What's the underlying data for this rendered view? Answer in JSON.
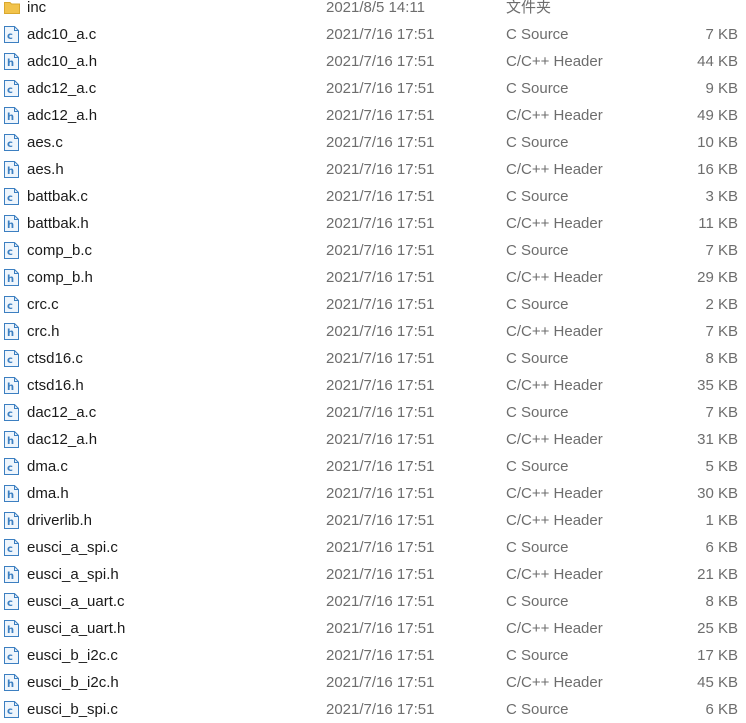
{
  "files": [
    {
      "name": "inc",
      "date": "2021/8/5 14:11",
      "type": "文件夹",
      "size": "",
      "icon": "folder-icon"
    },
    {
      "name": "adc10_a.c",
      "date": "2021/7/16 17:51",
      "type": "C Source",
      "size": "7 KB",
      "icon": "c-source-file-icon"
    },
    {
      "name": "adc10_a.h",
      "date": "2021/7/16 17:51",
      "type": "C/C++ Header",
      "size": "44 KB",
      "icon": "header-file-icon"
    },
    {
      "name": "adc12_a.c",
      "date": "2021/7/16 17:51",
      "type": "C Source",
      "size": "9 KB",
      "icon": "c-source-file-icon"
    },
    {
      "name": "adc12_a.h",
      "date": "2021/7/16 17:51",
      "type": "C/C++ Header",
      "size": "49 KB",
      "icon": "header-file-icon"
    },
    {
      "name": "aes.c",
      "date": "2021/7/16 17:51",
      "type": "C Source",
      "size": "10 KB",
      "icon": "c-source-file-icon"
    },
    {
      "name": "aes.h",
      "date": "2021/7/16 17:51",
      "type": "C/C++ Header",
      "size": "16 KB",
      "icon": "header-file-icon"
    },
    {
      "name": "battbak.c",
      "date": "2021/7/16 17:51",
      "type": "C Source",
      "size": "3 KB",
      "icon": "c-source-file-icon"
    },
    {
      "name": "battbak.h",
      "date": "2021/7/16 17:51",
      "type": "C/C++ Header",
      "size": "11 KB",
      "icon": "header-file-icon"
    },
    {
      "name": "comp_b.c",
      "date": "2021/7/16 17:51",
      "type": "C Source",
      "size": "7 KB",
      "icon": "c-source-file-icon"
    },
    {
      "name": "comp_b.h",
      "date": "2021/7/16 17:51",
      "type": "C/C++ Header",
      "size": "29 KB",
      "icon": "header-file-icon"
    },
    {
      "name": "crc.c",
      "date": "2021/7/16 17:51",
      "type": "C Source",
      "size": "2 KB",
      "icon": "c-source-file-icon"
    },
    {
      "name": "crc.h",
      "date": "2021/7/16 17:51",
      "type": "C/C++ Header",
      "size": "7 KB",
      "icon": "header-file-icon"
    },
    {
      "name": "ctsd16.c",
      "date": "2021/7/16 17:51",
      "type": "C Source",
      "size": "8 KB",
      "icon": "c-source-file-icon"
    },
    {
      "name": "ctsd16.h",
      "date": "2021/7/16 17:51",
      "type": "C/C++ Header",
      "size": "35 KB",
      "icon": "header-file-icon"
    },
    {
      "name": "dac12_a.c",
      "date": "2021/7/16 17:51",
      "type": "C Source",
      "size": "7 KB",
      "icon": "c-source-file-icon"
    },
    {
      "name": "dac12_a.h",
      "date": "2021/7/16 17:51",
      "type": "C/C++ Header",
      "size": "31 KB",
      "icon": "header-file-icon"
    },
    {
      "name": "dma.c",
      "date": "2021/7/16 17:51",
      "type": "C Source",
      "size": "5 KB",
      "icon": "c-source-file-icon"
    },
    {
      "name": "dma.h",
      "date": "2021/7/16 17:51",
      "type": "C/C++ Header",
      "size": "30 KB",
      "icon": "header-file-icon"
    },
    {
      "name": "driverlib.h",
      "date": "2021/7/16 17:51",
      "type": "C/C++ Header",
      "size": "1 KB",
      "icon": "header-file-icon"
    },
    {
      "name": "eusci_a_spi.c",
      "date": "2021/7/16 17:51",
      "type": "C Source",
      "size": "6 KB",
      "icon": "c-source-file-icon"
    },
    {
      "name": "eusci_a_spi.h",
      "date": "2021/7/16 17:51",
      "type": "C/C++ Header",
      "size": "21 KB",
      "icon": "header-file-icon"
    },
    {
      "name": "eusci_a_uart.c",
      "date": "2021/7/16 17:51",
      "type": "C Source",
      "size": "8 KB",
      "icon": "c-source-file-icon"
    },
    {
      "name": "eusci_a_uart.h",
      "date": "2021/7/16 17:51",
      "type": "C/C++ Header",
      "size": "25 KB",
      "icon": "header-file-icon"
    },
    {
      "name": "eusci_b_i2c.c",
      "date": "2021/7/16 17:51",
      "type": "C Source",
      "size": "17 KB",
      "icon": "c-source-file-icon"
    },
    {
      "name": "eusci_b_i2c.h",
      "date": "2021/7/16 17:51",
      "type": "C/C++ Header",
      "size": "45 KB",
      "icon": "header-file-icon"
    },
    {
      "name": "eusci_b_spi.c",
      "date": "2021/7/16 17:51",
      "type": "C Source",
      "size": "6 KB",
      "icon": "c-source-file-icon"
    }
  ],
  "colors": {
    "folder": "#f2c34b",
    "icon_blue": "#3c7fc1",
    "icon_bg": "#eef5fc"
  }
}
